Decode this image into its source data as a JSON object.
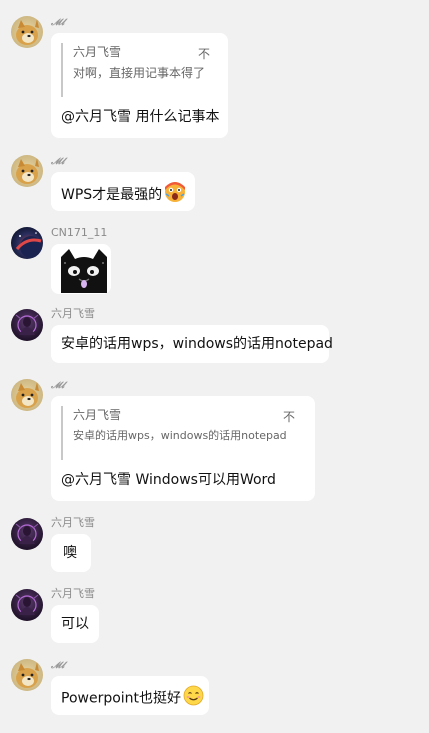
{
  "messages": [
    {
      "nickname": "𝓜𝓵",
      "quote": {
        "author": "六月飞雪",
        "glyph": "不",
        "text": "对啊，直接用记事本得了"
      },
      "text": "@六月飞雪 用什么记事本"
    },
    {
      "nickname": "𝓜𝓵",
      "text": "WPS才是最强的",
      "emoji": "shocked-face-emoji"
    },
    {
      "nickname": "CN171_11",
      "sticker": "black-cat-sticker"
    },
    {
      "nickname": "六月飞雪",
      "text": "安卓的话用wps，windows的话用notepad"
    },
    {
      "nickname": "𝓜𝓵",
      "quote": {
        "author": "六月飞雪",
        "glyph": "不",
        "text": "安卓的话用wps，windows的话用notepad"
      },
      "text": "@六月飞雪 Windows可以用Word"
    },
    {
      "nickname": "六月飞雪",
      "text": "噢"
    },
    {
      "nickname": "六月飞雪",
      "text": "可以"
    },
    {
      "nickname": "𝓜𝓵",
      "text": "Powerpoint也挺好",
      "emoji": "smiling-face-emoji"
    }
  ],
  "colors": {
    "background": "#f1f1f1",
    "bubble": "#ffffff",
    "nickname": "#8a8a8a"
  }
}
